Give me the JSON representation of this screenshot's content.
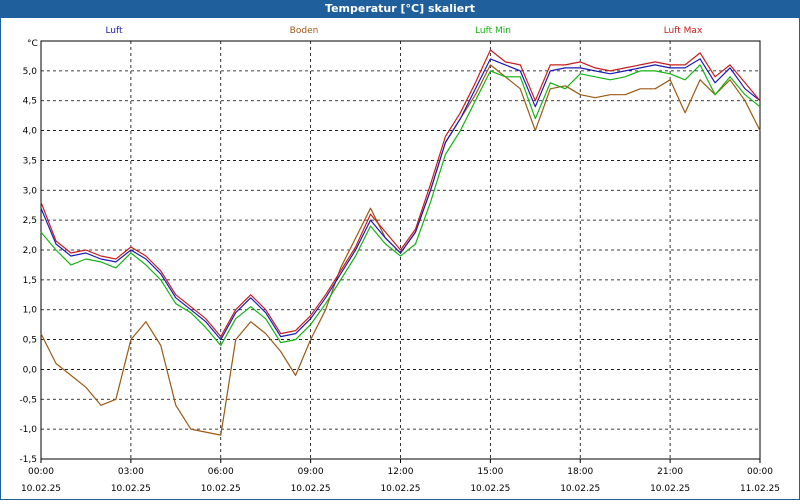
{
  "window": {
    "title": "Temperatur [°C] skaliert"
  },
  "chart_data": {
    "type": "line",
    "title": "Temperatur [°C] skaliert",
    "ylabel": "°C",
    "xlabel": "",
    "ylim": [
      -1.5,
      5.5
    ],
    "grid": true,
    "legend_position": "top",
    "yticks": [
      -1.5,
      -1.0,
      -0.5,
      0.0,
      0.5,
      1.0,
      1.5,
      2.0,
      2.5,
      3.0,
      3.5,
      4.0,
      4.5,
      5.0
    ],
    "ytick_labels": [
      "-1,5",
      "-1,0",
      "-0,5",
      "0,0",
      "0,5",
      "1,0",
      "1,5",
      "2,0",
      "2,5",
      "3,0",
      "3,5",
      "4,0",
      "4,5",
      "5,0"
    ],
    "xticks": [
      0,
      3,
      6,
      9,
      12,
      15,
      18,
      21,
      24
    ],
    "xtick_time_labels": [
      "00:00",
      "03:00",
      "06:00",
      "09:00",
      "12:00",
      "15:00",
      "18:00",
      "21:00",
      "00:00"
    ],
    "xtick_date_labels": [
      "10.02.25",
      "10.02.25",
      "10.02.25",
      "10.02.25",
      "10.02.25",
      "10.02.25",
      "10.02.25",
      "10.02.25",
      "11.02.25"
    ],
    "xlim": [
      0,
      24
    ],
    "x": [
      0,
      0.5,
      1,
      1.5,
      2,
      2.5,
      3,
      3.5,
      4,
      4.5,
      5,
      5.5,
      6,
      6.5,
      7,
      7.5,
      8,
      8.5,
      9,
      9.5,
      10,
      10.5,
      11,
      11.5,
      12,
      12.5,
      13,
      13.5,
      14,
      14.5,
      15,
      15.5,
      16,
      16.5,
      17,
      17.5,
      18,
      18.5,
      19,
      19.5,
      20,
      20.5,
      21,
      21.5,
      22,
      22.5,
      23,
      23.5,
      24
    ],
    "series": [
      {
        "name": "Luft",
        "color": "#1c1cb4",
        "values": [
          2.7,
          2.1,
          1.9,
          1.95,
          1.85,
          1.8,
          2.0,
          1.85,
          1.6,
          1.2,
          1.0,
          0.8,
          0.5,
          0.95,
          1.2,
          0.95,
          0.55,
          0.6,
          0.85,
          1.2,
          1.6,
          2.0,
          2.5,
          2.2,
          1.95,
          2.3,
          3.0,
          3.8,
          4.2,
          4.7,
          5.2,
          5.1,
          5.0,
          4.4,
          5.0,
          5.05,
          5.05,
          5.0,
          4.95,
          5.0,
          5.05,
          5.1,
          5.05,
          5.05,
          5.2,
          4.8,
          5.05,
          4.7,
          4.5
        ]
      },
      {
        "name": "Boden",
        "color": "#9c5a14",
        "values": [
          0.6,
          0.1,
          -0.1,
          -0.3,
          -0.6,
          -0.5,
          0.5,
          0.8,
          0.4,
          -0.6,
          -1.0,
          -1.05,
          -1.1,
          0.5,
          0.8,
          0.6,
          0.3,
          -0.1,
          0.5,
          1.0,
          1.7,
          2.2,
          2.7,
          2.2,
          1.95,
          2.3,
          3.0,
          3.8,
          4.2,
          4.6,
          5.1,
          4.9,
          4.7,
          4.0,
          4.7,
          4.75,
          4.6,
          4.55,
          4.6,
          4.6,
          4.7,
          4.7,
          4.85,
          4.3,
          4.85,
          4.6,
          4.85,
          4.5,
          4.0
        ]
      },
      {
        "name": "Luft Min",
        "color": "#14b414",
        "values": [
          2.3,
          2.0,
          1.75,
          1.85,
          1.8,
          1.7,
          1.95,
          1.75,
          1.5,
          1.1,
          0.95,
          0.7,
          0.4,
          0.85,
          1.05,
          0.85,
          0.45,
          0.5,
          0.75,
          1.1,
          1.5,
          1.9,
          2.4,
          2.1,
          1.9,
          2.1,
          2.8,
          3.6,
          4.0,
          4.5,
          5.0,
          4.9,
          4.9,
          4.2,
          4.8,
          4.7,
          4.95,
          4.9,
          4.85,
          4.9,
          5.0,
          5.0,
          4.95,
          4.85,
          5.1,
          4.6,
          4.9,
          4.6,
          4.4
        ]
      },
      {
        "name": "Luft Max",
        "color": "#c81e1e",
        "values": [
          2.8,
          2.15,
          1.95,
          2.0,
          1.9,
          1.85,
          2.05,
          1.9,
          1.65,
          1.25,
          1.05,
          0.85,
          0.55,
          1.0,
          1.25,
          1.0,
          0.6,
          0.65,
          0.9,
          1.25,
          1.65,
          2.05,
          2.6,
          2.3,
          2.0,
          2.35,
          3.1,
          3.9,
          4.3,
          4.8,
          5.35,
          5.15,
          5.1,
          4.5,
          5.1,
          5.1,
          5.15,
          5.05,
          5.0,
          5.05,
          5.1,
          5.15,
          5.1,
          5.1,
          5.3,
          4.9,
          5.1,
          4.8,
          4.5
        ]
      }
    ]
  }
}
